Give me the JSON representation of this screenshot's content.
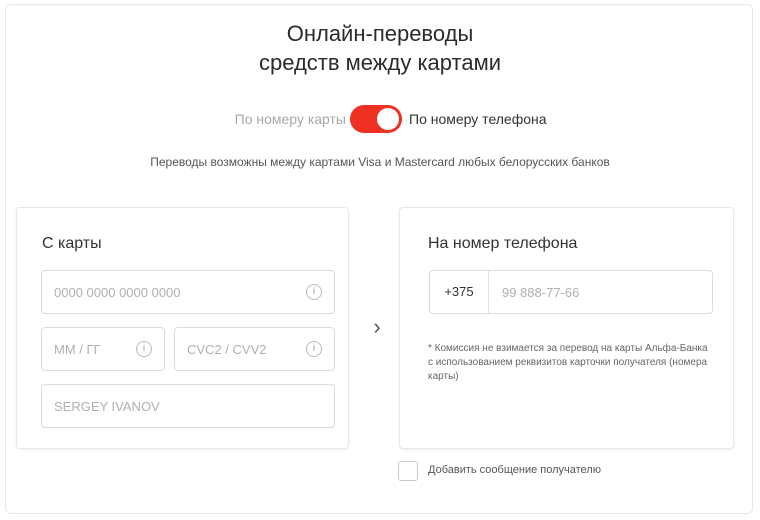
{
  "header": {
    "title_line1": "Онлайн-переводы",
    "title_line2": "средств между картами"
  },
  "mode_toggle": {
    "left_label": "По номеру карты",
    "right_label": "По номеру телефона",
    "state": "on",
    "accent_color": "#ef3124"
  },
  "subtitle": "Переводы возможны между картами Visa и Mastercard любых белорусских банков",
  "from_card": {
    "title": "С карты",
    "card_number": {
      "value": "",
      "placeholder": "0000 0000 0000 0000",
      "icon": "info-icon"
    },
    "expiry": {
      "value": "",
      "placeholder": "ММ / ГГ",
      "icon": "info-icon"
    },
    "cvc": {
      "value": "",
      "placeholder": "CVC2 / CVV2",
      "icon": "info-icon"
    },
    "holder": {
      "value": "",
      "placeholder": "SERGEY IVANOV"
    }
  },
  "arrow_icon": "chevron-right-icon",
  "to_phone": {
    "title": "На номер телефона",
    "prefix": "+375",
    "phone": {
      "value": "",
      "placeholder": "99 888-77-66"
    },
    "note": "* Комиссия не взимается за перевод на карты Альфа-Банка с использованием реквизитов карточки получателя (номера карты)"
  },
  "add_message": {
    "label": "Добавить сообщение получателю",
    "checked": false
  }
}
